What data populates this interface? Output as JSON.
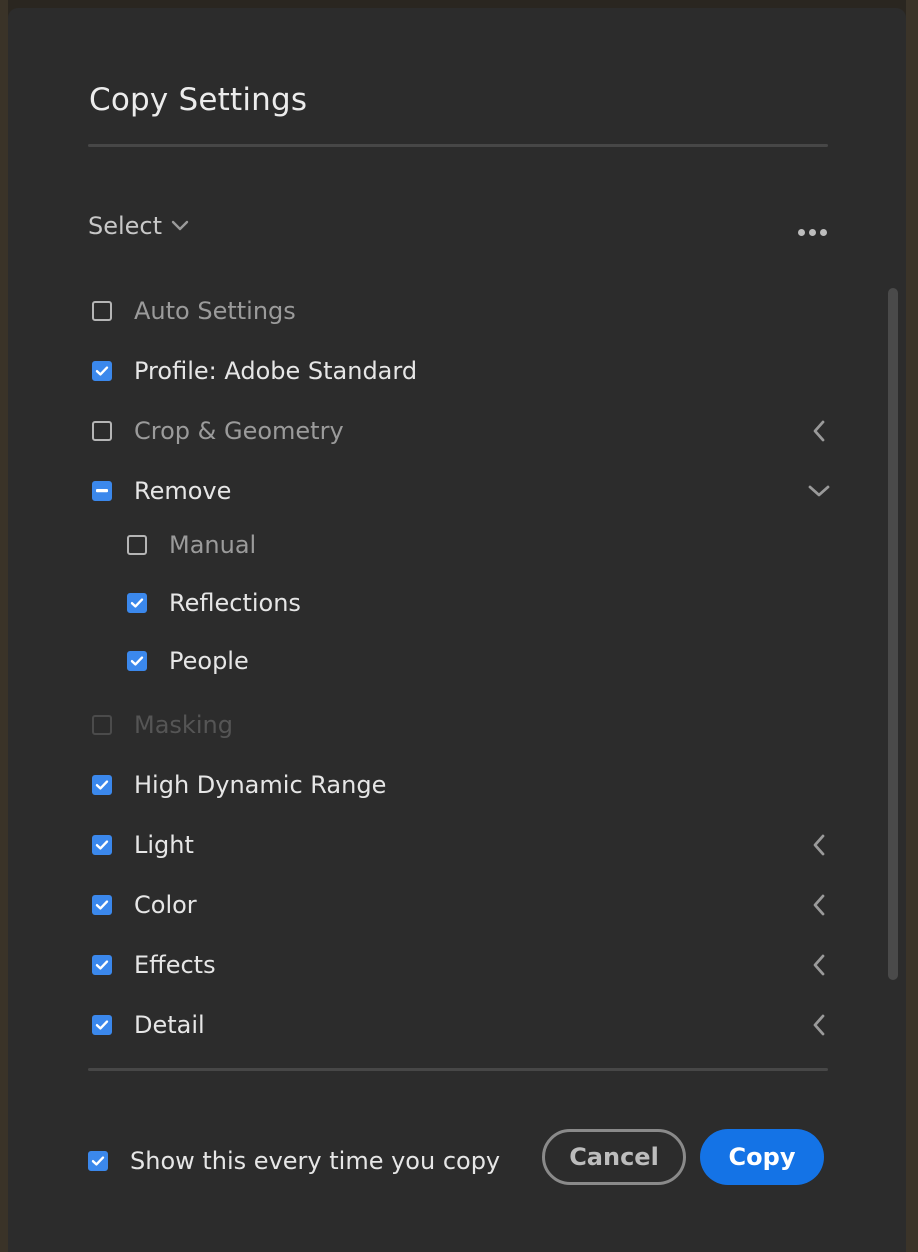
{
  "dialog": {
    "title": "Copy Settings",
    "select_label": "Select",
    "more_icon": "more-horizontal-icon"
  },
  "items": [
    {
      "label": "Auto Settings",
      "state": "unchecked",
      "style": "dim",
      "chevron": "none"
    },
    {
      "label": "Profile: Adobe Standard",
      "state": "checked",
      "style": "normal",
      "chevron": "none"
    },
    {
      "label": "Crop & Geometry",
      "state": "unchecked",
      "style": "dim",
      "chevron": "left"
    },
    {
      "label": "Remove",
      "state": "partial",
      "style": "normal",
      "chevron": "down"
    },
    {
      "label": "Manual",
      "state": "unchecked",
      "style": "dim",
      "chevron": "none",
      "indent": true
    },
    {
      "label": "Reflections",
      "state": "checked",
      "style": "normal",
      "chevron": "none",
      "indent": true
    },
    {
      "label": "People",
      "state": "checked",
      "style": "normal",
      "chevron": "none",
      "indent": true
    },
    {
      "label": "Masking",
      "state": "disabled",
      "style": "faded",
      "chevron": "none"
    },
    {
      "label": "High Dynamic Range",
      "state": "checked",
      "style": "normal",
      "chevron": "none"
    },
    {
      "label": "Light",
      "state": "checked",
      "style": "normal",
      "chevron": "left"
    },
    {
      "label": "Color",
      "state": "checked",
      "style": "normal",
      "chevron": "left"
    },
    {
      "label": "Effects",
      "state": "checked",
      "style": "normal",
      "chevron": "left"
    },
    {
      "label": "Detail",
      "state": "checked",
      "style": "normal",
      "chevron": "left"
    }
  ],
  "footer": {
    "show_every_time_label": "Show this every time you copy",
    "show_every_time_checked": true,
    "cancel_label": "Cancel",
    "copy_label": "Copy"
  },
  "colors": {
    "accent": "#1473e6",
    "checkbox": "#3b88ec",
    "panel": "#2c2c2c"
  }
}
